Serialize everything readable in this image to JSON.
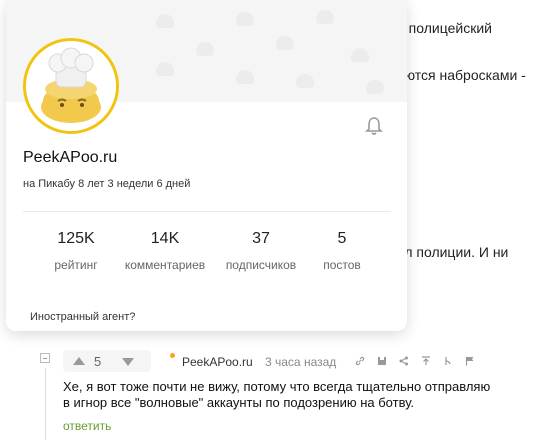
{
  "background": {
    "line1": "о полицейский",
    "line2": "яются набросками -",
    "line3": "ел полиции. И ни"
  },
  "profile": {
    "username": "PeekAPoo.ru",
    "member_since": "на Пикабу 8 лет 3 недели 6 дней",
    "stats": [
      {
        "value": "125K",
        "label": "рейтинг"
      },
      {
        "value": "14K",
        "label": "комментариев"
      },
      {
        "value": "37",
        "label": "подписчиков"
      },
      {
        "value": "5",
        "label": "постов"
      }
    ],
    "note": "Иностранный агент?",
    "avatar_border_color": "#f1c40f"
  },
  "comment": {
    "score": "5",
    "author": "PeekAPoo.ru",
    "time": "3 часа назад",
    "text": "Хе, я вот тоже почти не вижу, потому что всегда тщательно отправляю\nв игнор все \"волновые\" аккаунты по подозрению на ботву.",
    "reply_label": "ответить",
    "icons": [
      "link-icon",
      "save-icon",
      "share-icon",
      "pin-up-icon",
      "branch-icon",
      "flag-icon"
    ]
  }
}
